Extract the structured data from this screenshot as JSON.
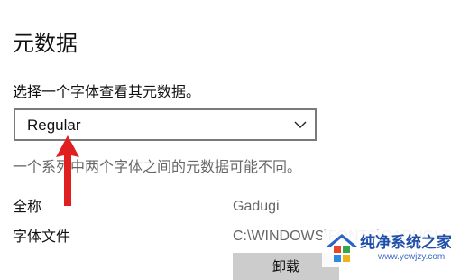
{
  "section": {
    "title": "元数据",
    "prompt": "选择一个字体查看其元数据。"
  },
  "font_select": {
    "selected": "Regular"
  },
  "hint": "一个系列中两个字体之间的元数据可能不同。",
  "metadata": {
    "full_name_label": "全称",
    "full_name_value": "Gadugi",
    "file_label": "字体文件",
    "file_value": "C:\\WINDOWS\\FONTS\\GADUGI.TTF"
  },
  "uninstall_label": "卸载",
  "watermark": {
    "name": "纯净系统之家",
    "url": "www.ycwjzy.com"
  },
  "colors": {
    "arrow": "#e02020",
    "select_border": "#7a7a7a",
    "button_bg": "#cccccc",
    "hint_text": "#666666"
  },
  "icons": {
    "dropdown": "chevron-down-icon",
    "annotation": "red-arrow-icon",
    "watermark_logo": "windows-house-logo"
  }
}
